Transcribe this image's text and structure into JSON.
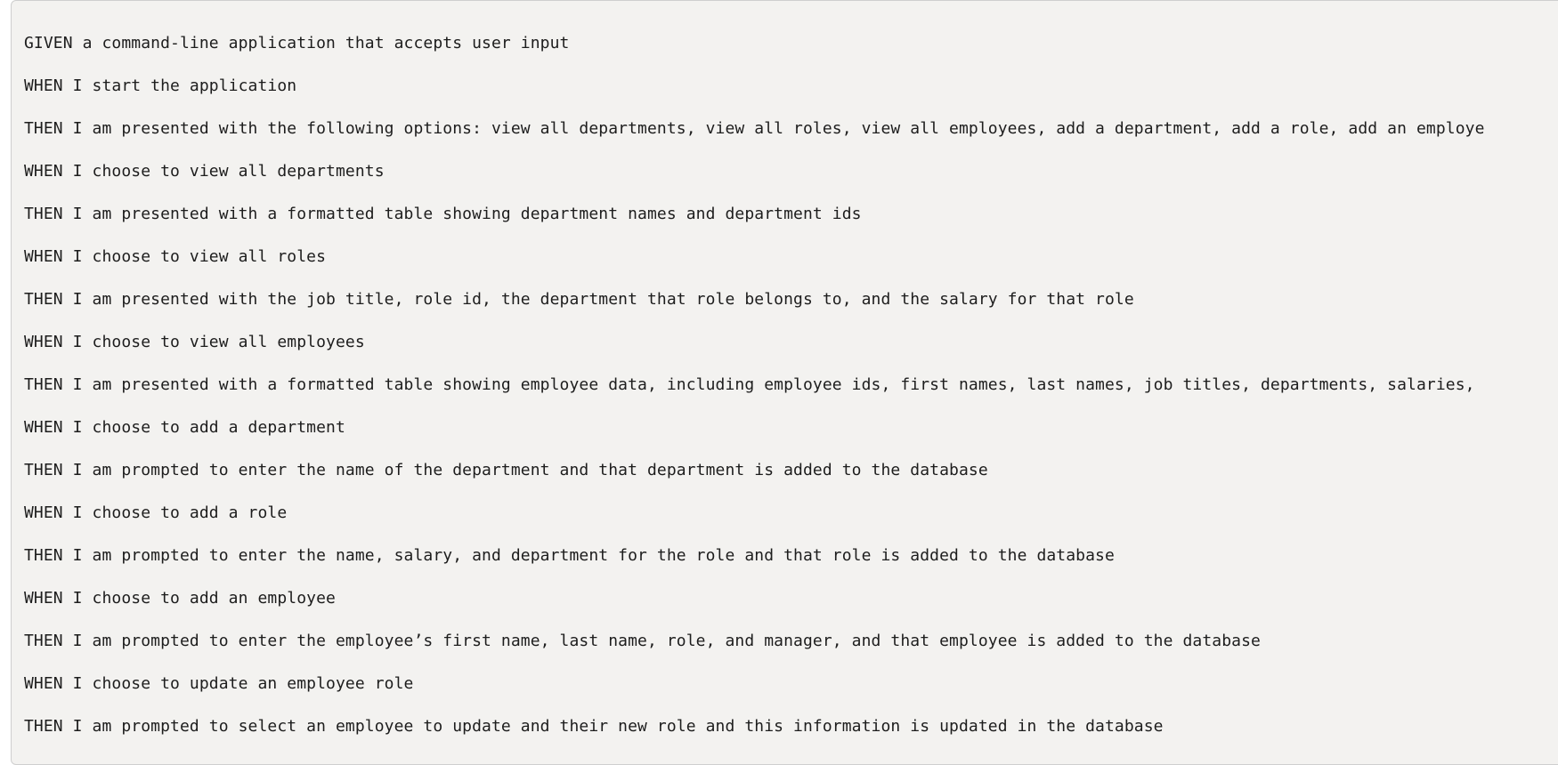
{
  "code_block": {
    "lines": [
      "GIVEN a command-line application that accepts user input",
      "WHEN I start the application",
      "THEN I am presented with the following options: view all departments, view all roles, view all employees, add a department, add a role, add an employe",
      "WHEN I choose to view all departments",
      "THEN I am presented with a formatted table showing department names and department ids",
      "WHEN I choose to view all roles",
      "THEN I am presented with the job title, role id, the department that role belongs to, and the salary for that role",
      "WHEN I choose to view all employees",
      "THEN I am presented with a formatted table showing employee data, including employee ids, first names, last names, job titles, departments, salaries,",
      "WHEN I choose to add a department",
      "THEN I am prompted to enter the name of the department and that department is added to the database",
      "WHEN I choose to add a role",
      "THEN I am prompted to enter the name, salary, and department for the role and that role is added to the database",
      "WHEN I choose to add an employee",
      "THEN I am prompted to enter the employee’s first name, last name, role, and manager, and that employee is added to the database",
      "WHEN I choose to update an employee role",
      "THEN I am prompted to select an employee to update and their new role and this information is updated in the database"
    ]
  }
}
